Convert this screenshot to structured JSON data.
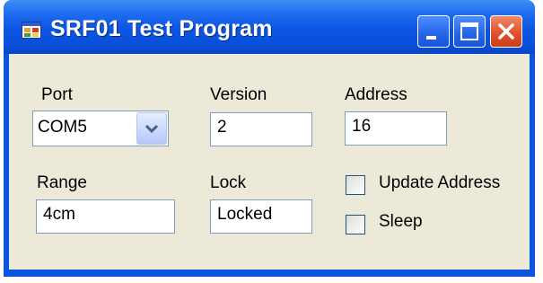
{
  "window": {
    "title": "SRF01 Test Program",
    "controls": {
      "minimize": "minimize-icon",
      "maximize": "maximize-icon",
      "close": "close-icon"
    },
    "colors": {
      "titlebar": "#0a54e0",
      "client": "#ece9d8",
      "close": "#e0532c"
    }
  },
  "form": {
    "port": {
      "label": "Port",
      "value": "COM5",
      "icon": "chevron-down-icon"
    },
    "version": {
      "label": "Version",
      "value": "2"
    },
    "address": {
      "label": "Address",
      "value": "16"
    },
    "range": {
      "label": "Range",
      "value": "4cm"
    },
    "lock": {
      "label": "Lock",
      "value": "Locked"
    },
    "update_address": {
      "label": "Update Address",
      "checked": false
    },
    "sleep": {
      "label": "Sleep",
      "checked": false
    }
  }
}
